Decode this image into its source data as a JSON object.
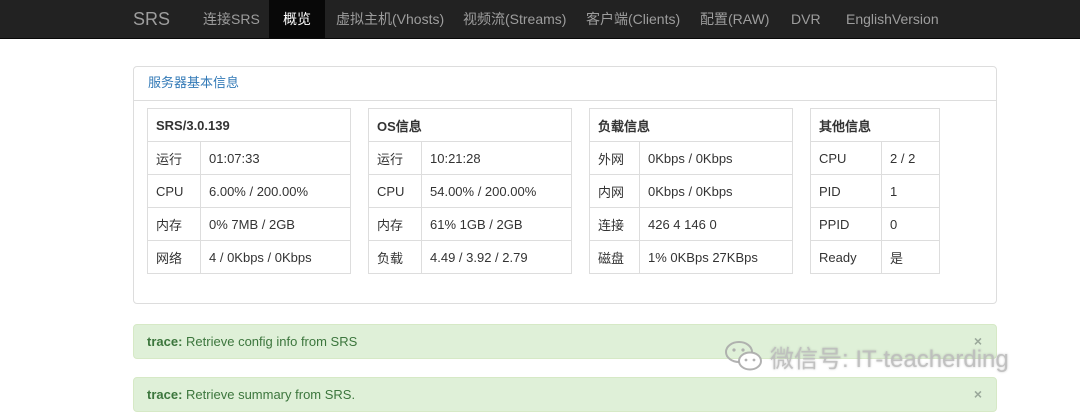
{
  "navbar": {
    "brand": "SRS",
    "items": [
      {
        "label": "连接SRS",
        "active": false
      },
      {
        "label": "概览",
        "active": true
      },
      {
        "label": "虚拟主机(Vhosts)",
        "active": false
      },
      {
        "label": "视频流(Streams)",
        "active": false
      },
      {
        "label": "客户端(Clients)",
        "active": false
      },
      {
        "label": "配置(RAW)",
        "active": false
      },
      {
        "label": "DVR",
        "active": false
      },
      {
        "label": "EnglishVersion",
        "active": false
      }
    ]
  },
  "panel": {
    "title": "服务器基本信息"
  },
  "srs_table": {
    "title": "SRS/3.0.139",
    "rows": [
      {
        "key": "运行",
        "value": "01:07:33"
      },
      {
        "key": "CPU",
        "value": "6.00% / 200.00%"
      },
      {
        "key": "内存",
        "value": "0% 7MB / 2GB"
      },
      {
        "key": "网络",
        "value": "4 / 0Kbps / 0Kbps"
      }
    ]
  },
  "os_table": {
    "title": "OS信息",
    "rows": [
      {
        "key": "运行",
        "value": "10:21:28"
      },
      {
        "key": "CPU",
        "value": "54.00% / 200.00%"
      },
      {
        "key": "内存",
        "value": "61% 1GB / 2GB"
      },
      {
        "key": "负载",
        "value": "4.49 / 3.92 / 2.79"
      }
    ]
  },
  "load_table": {
    "title": "负载信息",
    "rows": [
      {
        "key": "外网",
        "value": "0Kbps / 0Kbps"
      },
      {
        "key": "内网",
        "value": "0Kbps / 0Kbps"
      },
      {
        "key": "连接",
        "value": "426 4 146 0"
      },
      {
        "key": "磁盘",
        "value": "1% 0KBps 27KBps"
      }
    ]
  },
  "other_table": {
    "title": "其他信息",
    "rows": [
      {
        "key": "CPU",
        "value": "2 / 2"
      },
      {
        "key": "PID",
        "value": "1"
      },
      {
        "key": "PPID",
        "value": "0"
      },
      {
        "key": "Ready",
        "value": "是"
      }
    ]
  },
  "alerts": [
    {
      "prefix": "trace:",
      "message": "Retrieve config info from SRS",
      "close": "×"
    },
    {
      "prefix": "trace:",
      "message": "Retrieve summary from SRS.",
      "close": "×"
    }
  ],
  "watermark": {
    "text": "微信号: IT-teacherding",
    "icon": "wechat-icon"
  },
  "colors": {
    "navbar_bg": "#222222",
    "nav_active_bg": "#080808",
    "alert_bg": "#dff0d8",
    "alert_text": "#3c763d",
    "panel_title": "#337ab7"
  }
}
